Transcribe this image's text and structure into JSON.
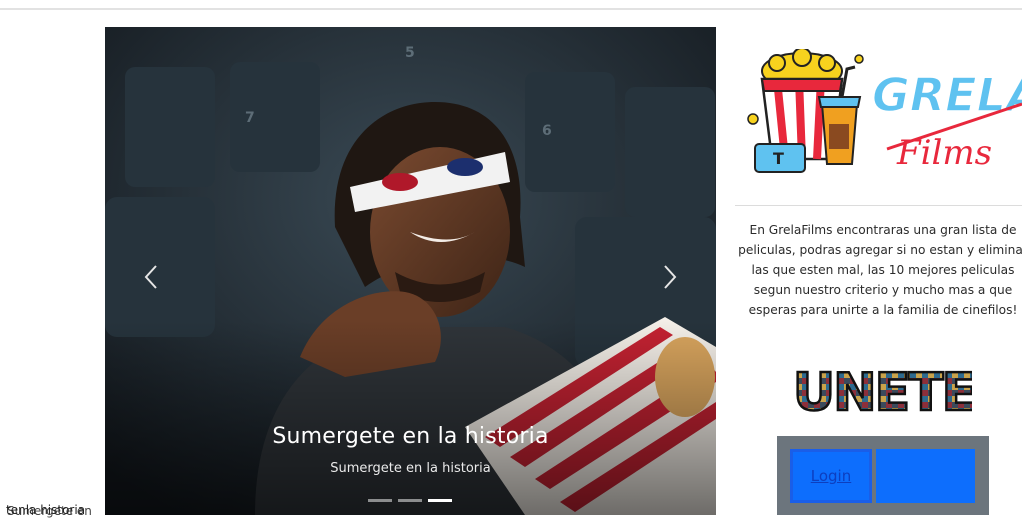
{
  "carousel": {
    "caption_title": "Sumergete en la historia",
    "caption_subtitle": "Sumergete en la historia",
    "prev_glyph": "‹",
    "next_glyph": "›",
    "indicators": [
      "slide-1",
      "slide-2",
      "slide-3"
    ],
    "active_indicator": 3
  },
  "stray_text": {
    "line_a": "tenla historia",
    "line_b": "Sumergete en"
  },
  "sidebar": {
    "logo_text_top": "GRELA",
    "logo_text_bottom": "Films",
    "description": "En GrelaFilms encontraras una gran lista de peliculas, podras agregar si no estan y eliminar las que esten mal, las 10 mejores peliculas segun nuestro criterio y mucho mas a que esperas para unirte a la familia de cinefilos!",
    "join_label": "UNETE",
    "login_label": "Login"
  },
  "colors": {
    "primary_button": "#0d6efd",
    "login_panel": "#6c757d",
    "logo_blue": "#5fc2f0",
    "logo_red": "#e8283c"
  }
}
